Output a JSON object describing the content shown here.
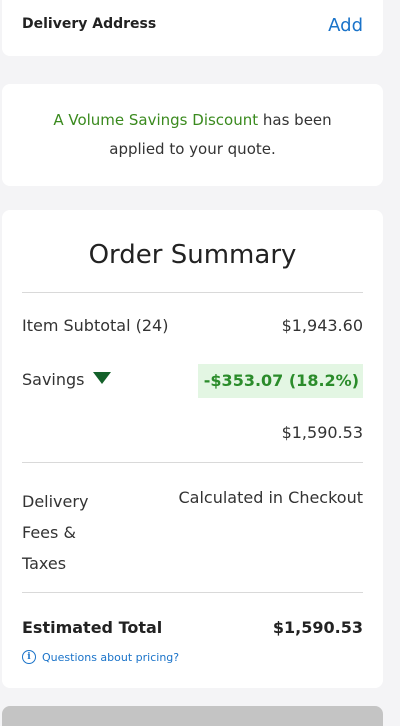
{
  "delivery_address": {
    "title": "Delivery Address",
    "add_label": "Add"
  },
  "notice": {
    "highlight": "A Volume Savings Discount",
    "rest": " has been applied to your quote."
  },
  "summary": {
    "title": "Order Summary",
    "item_subtotal_label": "Item Subtotal (24)",
    "item_subtotal_value": "$1,943.60",
    "savings_label": "Savings",
    "savings_value": "-$353.07 (18.2%)",
    "discounted_subtotal": "$1,590.53",
    "delivery_label": "Delivery Fees & Taxes",
    "delivery_value": "Calculated in Checkout",
    "estimated_total_label": "Estimated Total",
    "estimated_total_value": "$1,590.53",
    "pricing_link": "Questions about pricing?",
    "info_icon_glyph": "i"
  },
  "colors": {
    "link": "#1a73c9",
    "savings_text": "#2b8c2b",
    "savings_bg": "#e3f6e3",
    "caret": "#14612a",
    "highlight": "#3a8a1e"
  }
}
